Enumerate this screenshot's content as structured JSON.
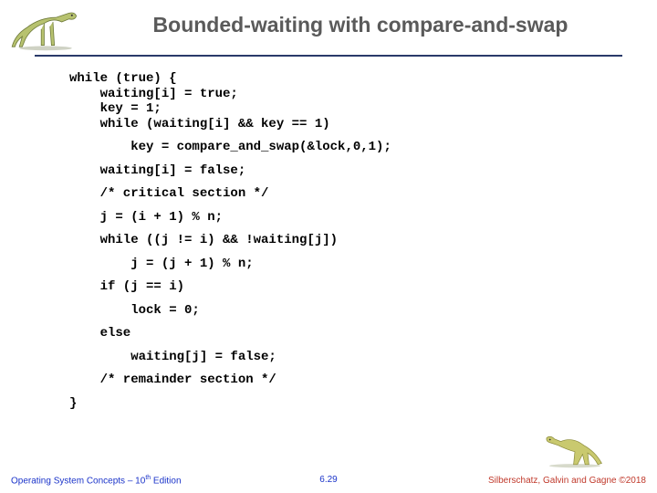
{
  "title": "Bounded-waiting with compare-and-swap",
  "code": {
    "l1": "while (true) {",
    "l2": "    waiting[i] = true;",
    "l3": "    key = 1;",
    "l4": "    while (waiting[i] && key == 1)",
    "l5": "        key = compare_and_swap(&lock,0,1);",
    "l6": "    waiting[i] = false;",
    "l7": "    /* critical section */",
    "l8": "    j = (i + 1) % n;",
    "l9": "    while ((j != i) && !waiting[j])",
    "l10": "        j = (j + 1) % n;",
    "l11": "    if (j == i)",
    "l12": "        lock = 0;",
    "l13": "    else",
    "l14": "        waiting[j] = false;",
    "l15": "    /* remainder section */",
    "l16": "}"
  },
  "footer": {
    "left_a": "Operating System Concepts – 10",
    "left_sup": "th",
    "left_b": " Edition",
    "center": "6.29",
    "right": "Silberschatz, Galvin and Gagne ©2018"
  }
}
